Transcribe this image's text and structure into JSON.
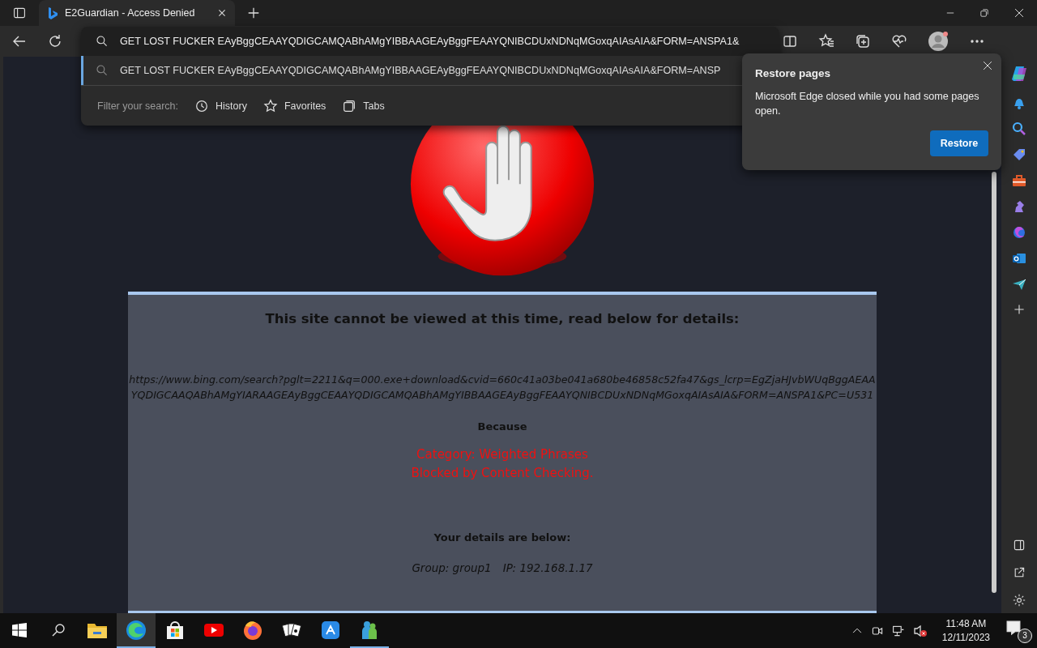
{
  "window": {
    "tab": {
      "title": "E2Guardian - Access Denied",
      "selected": true
    }
  },
  "address_bar": {
    "value": "GET LOST FUCKER EAyBggCEAAYQDIGCAMQABhAMgYIBBAAGEAyBggFEAAYQNIBCDUxNDNqMGoxqAIAsAIA&FORM=ANSPA1&"
  },
  "suggestions": [
    {
      "text": "GET LOST FUCKER EAyBggCEAAYQDIGCAMQABhAMgYIBBAAGEAyBggFEAAYQNIBCDUxNDNqMGoxqAIAsAIA&FORM=ANSP",
      "selected": true
    }
  ],
  "filter": {
    "label": "Filter your search:",
    "options": [
      {
        "kind": "history",
        "label": "History"
      },
      {
        "kind": "favorites",
        "label": "Favorites"
      },
      {
        "kind": "tabs",
        "label": "Tabs"
      }
    ]
  },
  "page": {
    "heading": "This site cannot be viewed at this time, read below for details:",
    "url": "https://www.bing.com/search?pglt=2211&q=000.exe+download&cvid=660c41a03be041a680be46858c52fa47&gs_lcrp=EgZjaHJvbWUqBggAEAAYQDIGCAAQABhAMgYIARAAGEAyBggCEAAYQDIGCAMQABhAMgYIBBAAGEAyBggFEAAYQNIBCDUxNDNqMGoxqAIAsAIA&FORM=ANSPA1&PC=U531",
    "because_label": "Because",
    "reasons": [
      "Category: Weighted Phrases",
      "Blocked by Content Checking."
    ],
    "details_heading": "Your details are below:",
    "group": "Group: group1",
    "ip": "IP: 192.168.1.17"
  },
  "popup": {
    "title": "Restore pages",
    "message": "Microsoft Edge closed while you had some pages open.",
    "button": "Restore"
  },
  "taskbar": {
    "apps": [
      {
        "kind": "explorer",
        "selected": false,
        "running": false
      },
      {
        "kind": "edge",
        "selected": true,
        "running": true
      },
      {
        "kind": "store",
        "selected": false,
        "running": false
      },
      {
        "kind": "youtube",
        "selected": false,
        "running": false
      },
      {
        "kind": "firefox",
        "selected": false,
        "running": false
      },
      {
        "kind": "cards",
        "selected": false,
        "running": false
      },
      {
        "kind": "appstore",
        "selected": false,
        "running": false
      },
      {
        "kind": "people",
        "selected": false,
        "running": true
      }
    ],
    "time": "11:48 AM",
    "date": "12/11/2023",
    "notifications": "3"
  }
}
